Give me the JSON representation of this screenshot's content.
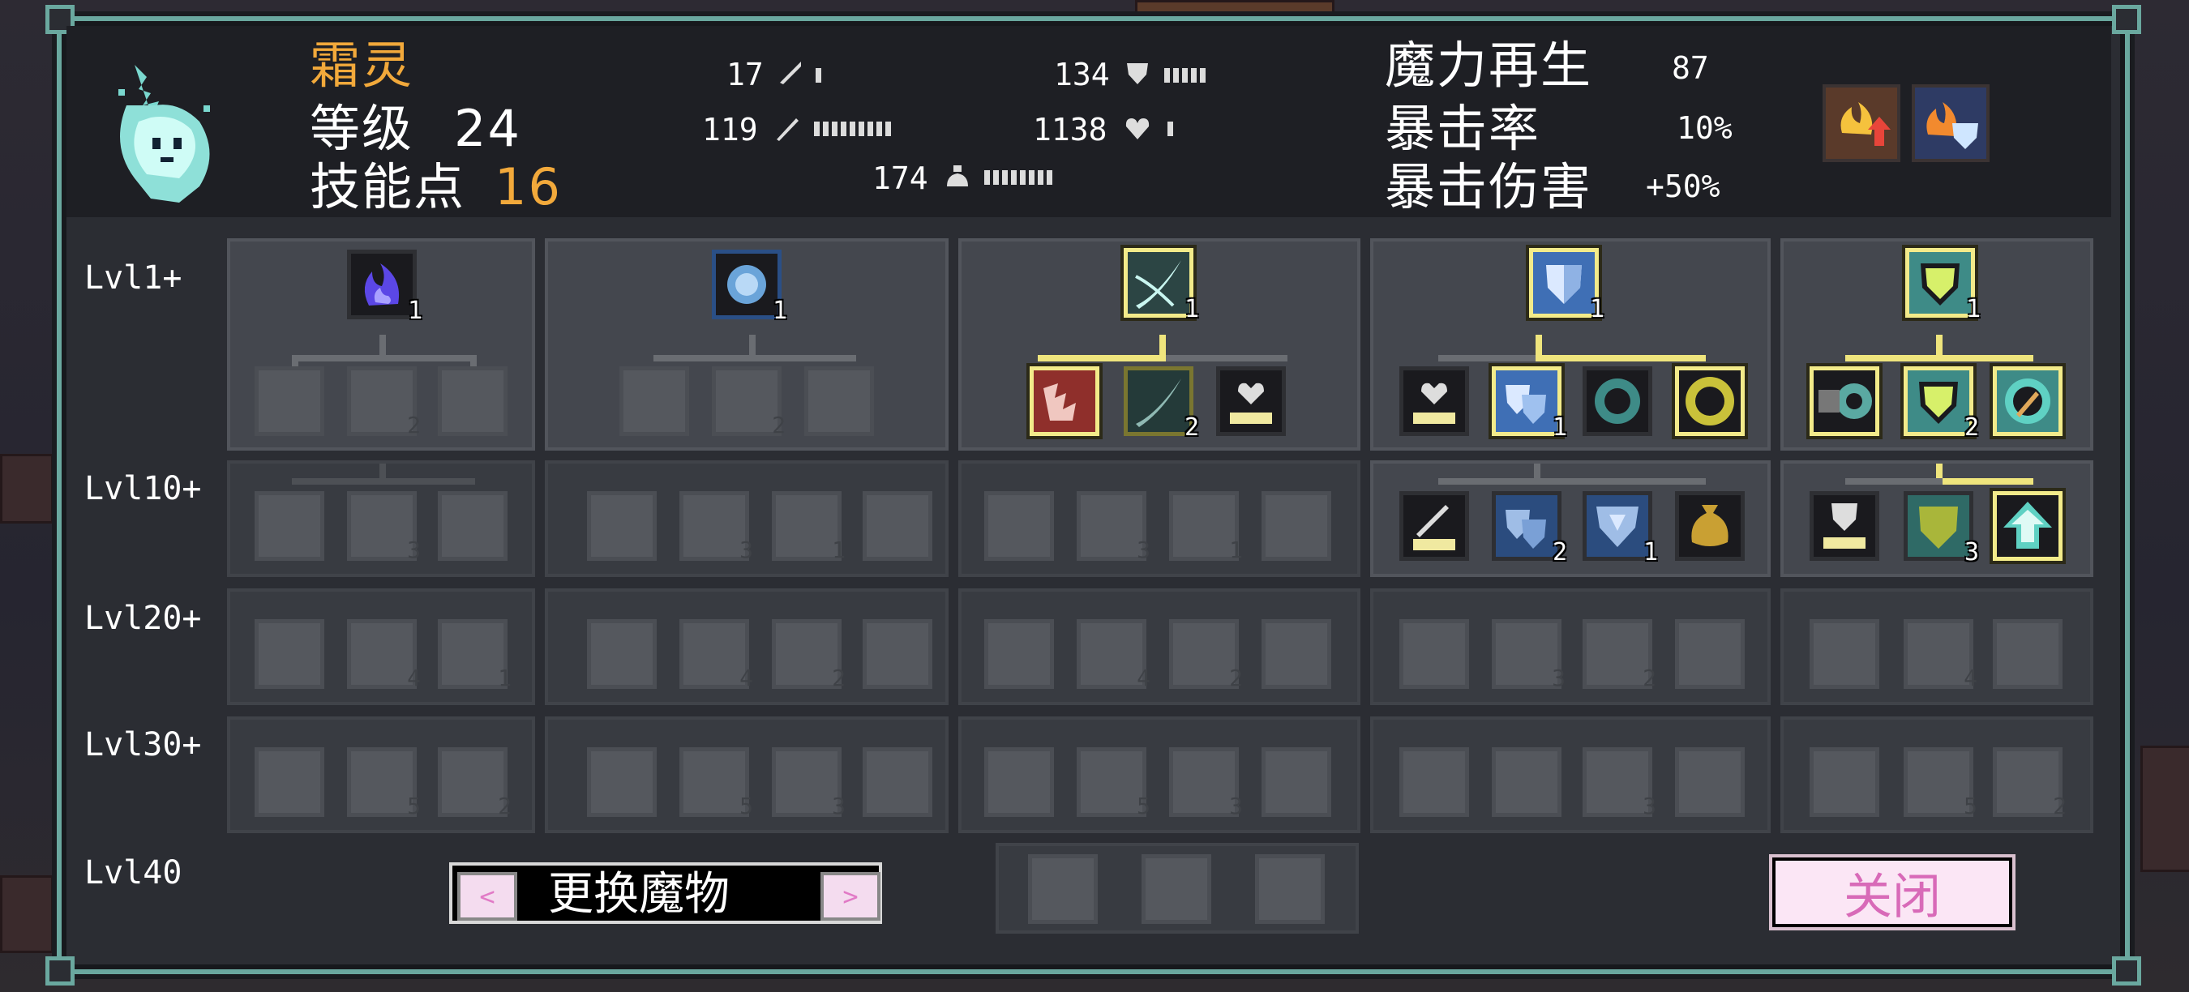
{
  "monster": {
    "name": "霜灵",
    "level_label": "等级",
    "level_value": "24",
    "skill_points_label": "技能点",
    "skill_points_value": "16"
  },
  "stats": {
    "attack": "17",
    "magic_attack": "119",
    "defense": "134",
    "magic_defense": "1138",
    "health": "174",
    "mana_regen_label": "魔力再生",
    "mana_regen_value": "87",
    "crit_rate_label": "暴击率",
    "crit_rate_value": "10%",
    "crit_damage_label": "暴击伤害",
    "crit_damage_value": "+50%"
  },
  "buffs": [
    {
      "icon": "fire-attack-up-icon"
    },
    {
      "icon": "fire-shield-icon"
    }
  ],
  "row_labels": [
    "Lvl1+",
    "Lvl10+",
    "Lvl20+",
    "Lvl30+",
    "Lvl40"
  ],
  "skill_levels": {
    "t1_root": "1",
    "t1_r1_2": "2",
    "t1_r2_2": "3",
    "t1_r3_2": "4",
    "t1_r3_3": "1",
    "t1_r4_2": "5",
    "t1_r4_3": "2",
    "t2_root": "1",
    "t2_r1_2": "2",
    "t2_r2_2": "3",
    "t2_r2_3": "1",
    "t2_r3_2": "4",
    "t2_r3_3": "2",
    "t2_r4_2": "5",
    "t2_r4_3": "3",
    "t3_root": "1",
    "t3_r1_2": "2",
    "t3_r2_2": "3",
    "t3_r2_3": "1",
    "t3_r3_2": "4",
    "t3_r3_3": "2",
    "t3_r4_2": "5",
    "t3_r4_3": "3",
    "t4_root": "1",
    "t4_r1_2": "1",
    "t4_r2_2": "2",
    "t4_r2_3": "1",
    "t4_r3_2": "3",
    "t4_r3_3": "2",
    "t4_r4_3": "3",
    "t5_root": "1",
    "t5_r1_2": "2",
    "t5_r2_2": "3",
    "t5_r3_2": "4",
    "t5_r4_2": "5",
    "t5_r4_3": "2"
  },
  "buttons": {
    "change_monster": "更换魔物",
    "prev": "<",
    "next": ">",
    "close": "关闭"
  },
  "colors": {
    "accent_orange": "#f2a93b",
    "frame_teal": "#6aa89f",
    "selected_yellow": "#f3eb8a",
    "panel_bg": "#44474e"
  }
}
